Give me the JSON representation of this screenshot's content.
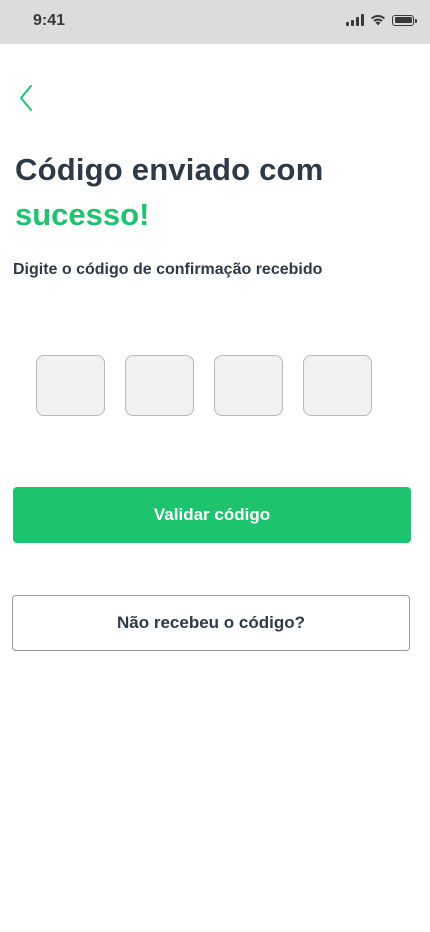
{
  "status_bar": {
    "time": "9:41",
    "icons": [
      "signal-icon",
      "wifi-icon",
      "battery-icon"
    ]
  },
  "header": {
    "back_icon": "chevron-left-icon"
  },
  "title": {
    "line1": "Código enviado com",
    "line2": "sucesso!"
  },
  "subtitle": "Digite o código de confirmação recebido",
  "code": {
    "digits": [
      "",
      "",
      "",
      ""
    ]
  },
  "actions": {
    "validate_label": "Validar código",
    "resend_label": "Não recebeu o código?"
  },
  "colors": {
    "accent": "#1ec36e",
    "text": "#2e3a48",
    "status_bar_bg": "#dcdcdc",
    "input_bg": "#f1f1f1"
  }
}
